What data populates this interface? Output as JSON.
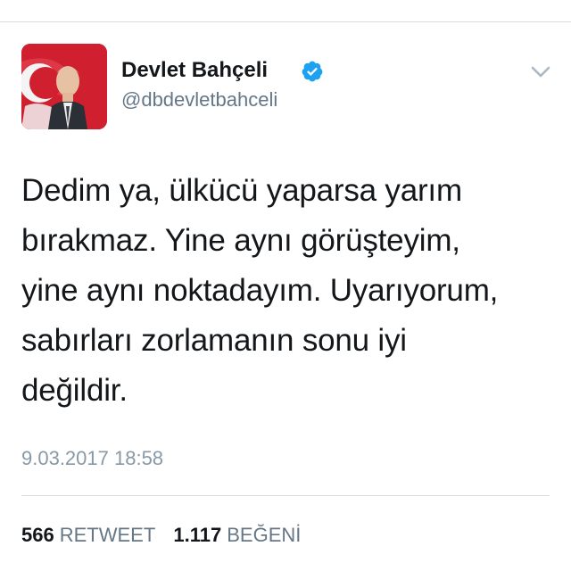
{
  "tweet": {
    "author": {
      "display_name": "Devlet Bahçeli",
      "handle": "@dbdevletbahceli",
      "verified": true,
      "verified_color": "#1da1f2"
    },
    "text_lines": [
      "Dedim ya, ülkücü yaparsa yarım",
      "bırakmaz. Yine aynı görüşteyim,",
      "yine aynı noktadayım. Uyarıyorum,",
      "sabırları zorlamanın sonu iyi",
      "değildir."
    ],
    "timestamp": "9.03.2017 18:58",
    "stats": {
      "retweet_count": "566",
      "retweet_label": "RETWEET",
      "like_count": "1.117",
      "like_label": "BEĞENİ"
    },
    "icons": {
      "verified": "verified-badge-icon",
      "menu": "chevron-down-icon"
    }
  }
}
